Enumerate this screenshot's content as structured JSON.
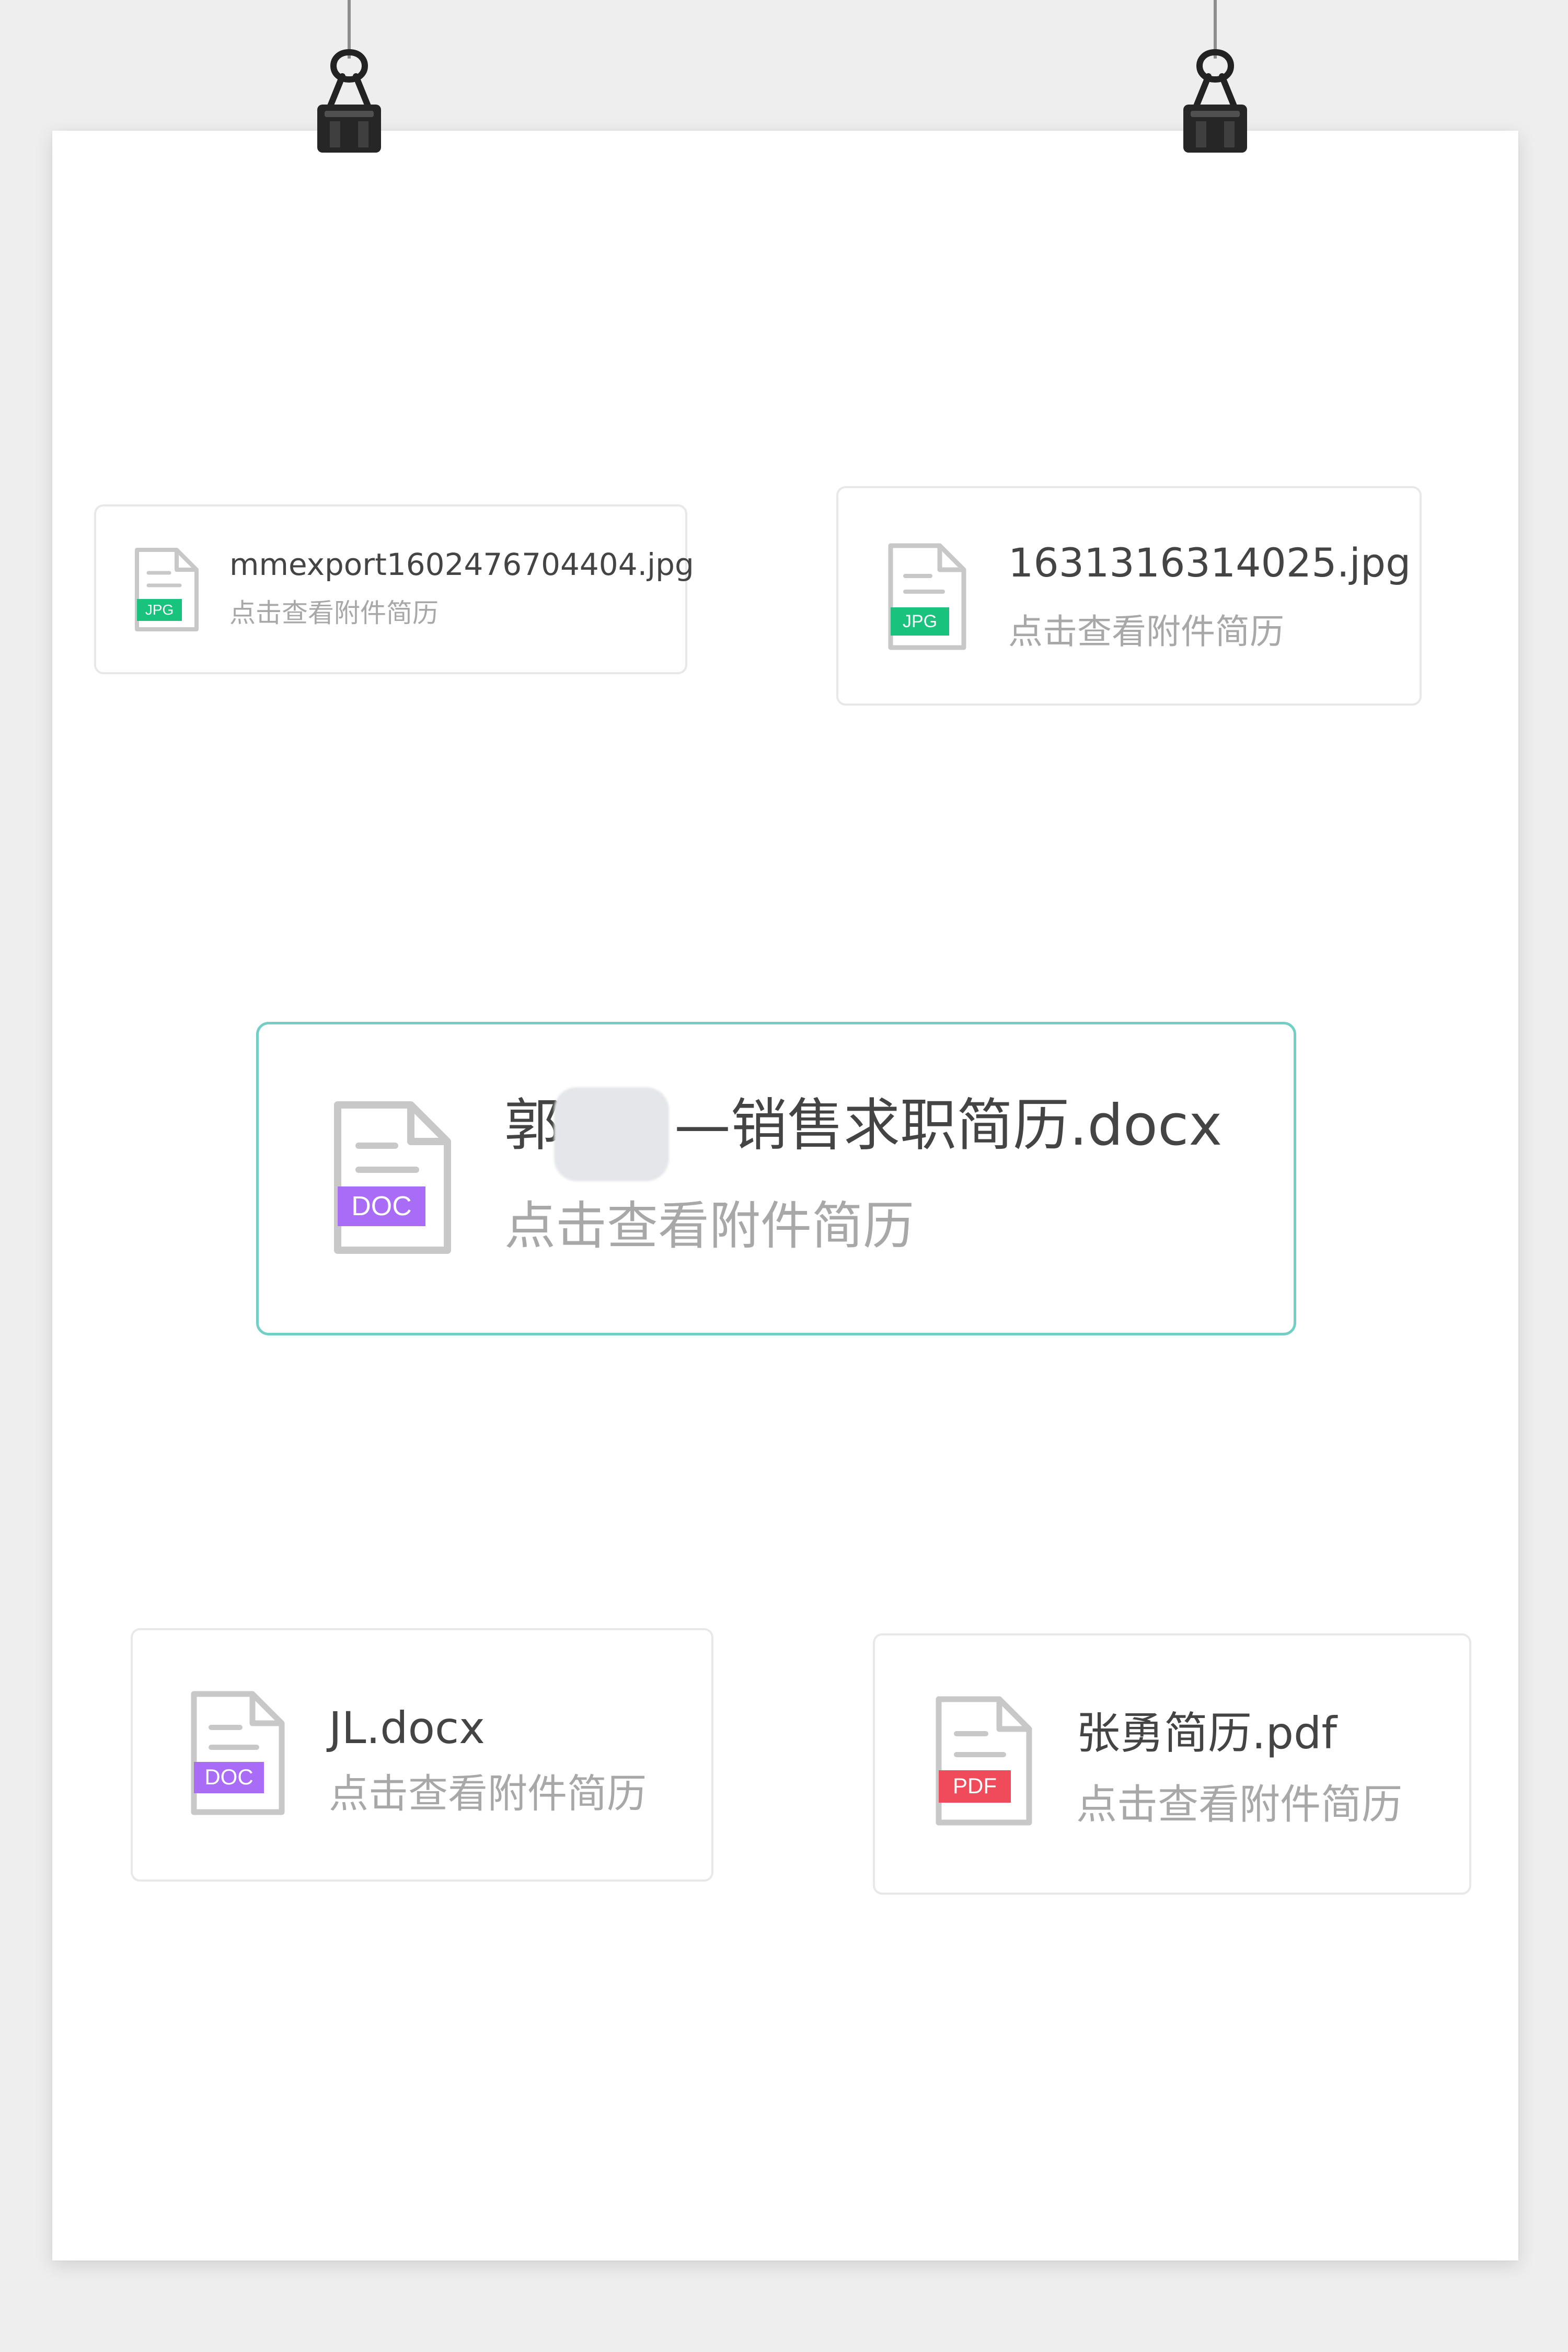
{
  "cards": [
    {
      "name": "mmexport1602476704404.jpg",
      "subtitle": "点击查看附件简历",
      "file_type": "JPG"
    },
    {
      "name": "1631316314025.jpg",
      "subtitle": "点击查看附件简历",
      "file_type": "JPG"
    },
    {
      "name_prefix": "郭",
      "name_suffix": "—销售求职简历.docx",
      "subtitle": "点击查看附件简历",
      "file_type": "DOC"
    },
    {
      "name": "JL.docx",
      "subtitle": "点击查看附件简历",
      "file_type": "DOC"
    },
    {
      "name": "张勇简历.pdf",
      "subtitle": "点击查看附件简历",
      "file_type": "PDF"
    }
  ],
  "icons": [
    "file-icon",
    "binder-clip-icon"
  ],
  "colors": {
    "jpg_badge": "#19c37d",
    "doc_badge": "#a86cf7",
    "pdf_badge": "#f04b5a",
    "active_border": "#72cfc5",
    "card_border": "#e8e8e8",
    "title_text": "#444444",
    "subtitle_text": "#a8a8a8"
  }
}
